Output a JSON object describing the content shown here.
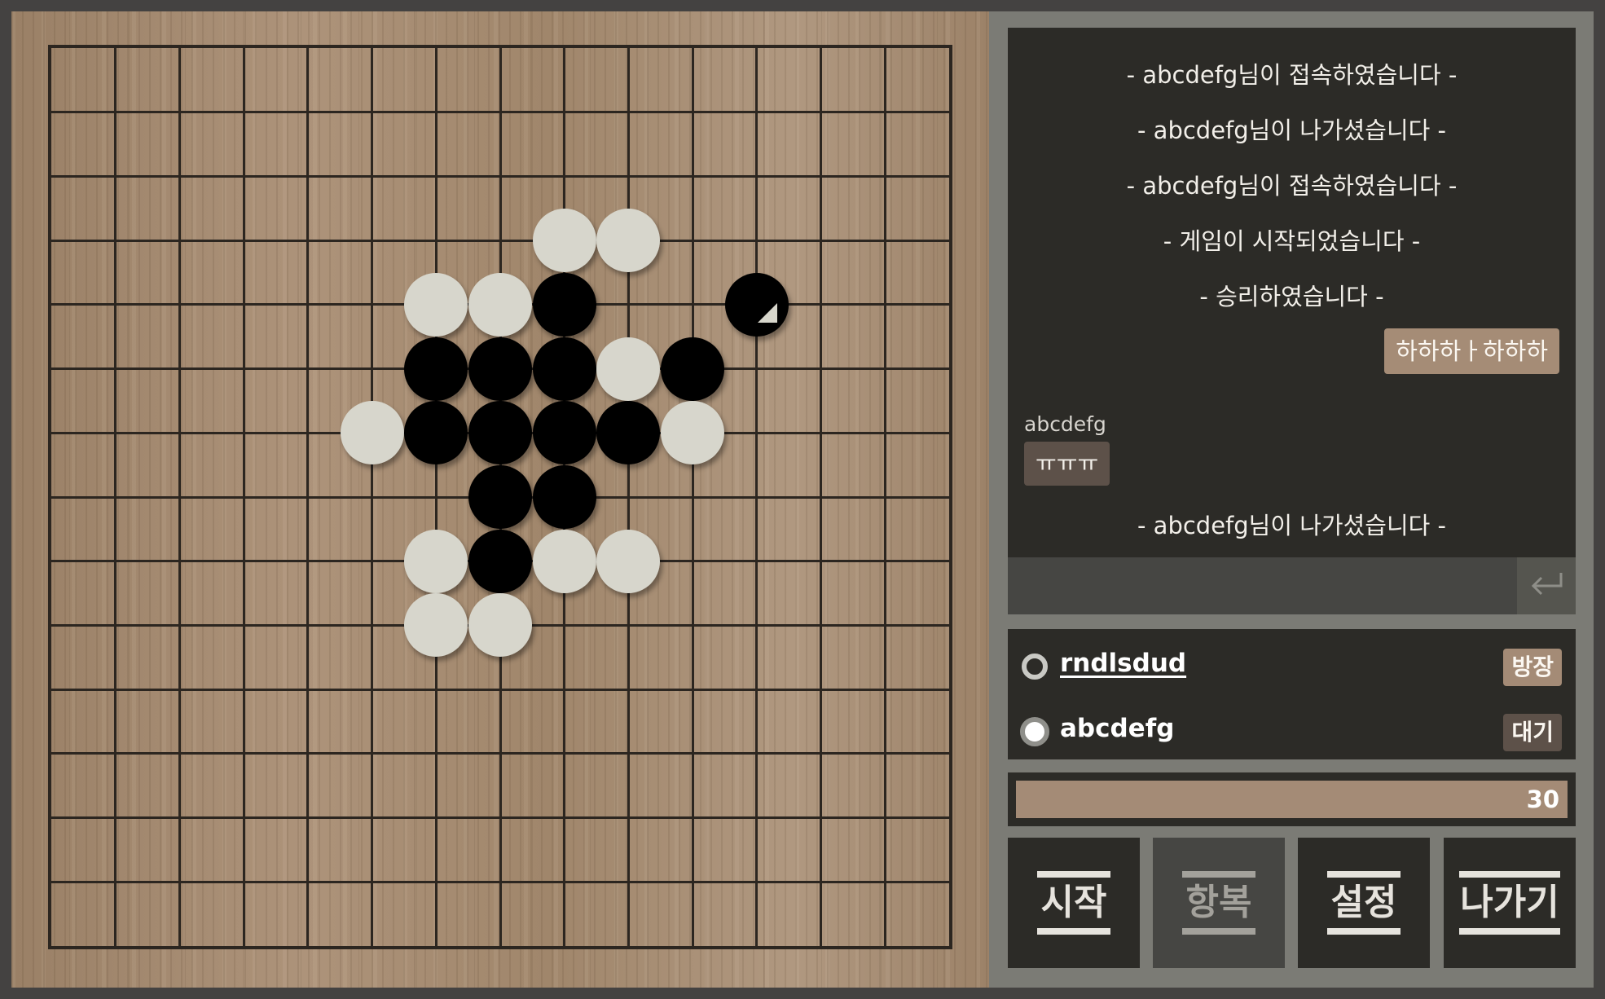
{
  "board": {
    "size": 15,
    "stones": [
      {
        "row": 3,
        "col": 8,
        "color": "white"
      },
      {
        "row": 3,
        "col": 9,
        "color": "white"
      },
      {
        "row": 4,
        "col": 6,
        "color": "white"
      },
      {
        "row": 4,
        "col": 7,
        "color": "white"
      },
      {
        "row": 4,
        "col": 8,
        "color": "black"
      },
      {
        "row": 4,
        "col": 11,
        "color": "black",
        "last_move": true
      },
      {
        "row": 5,
        "col": 6,
        "color": "black"
      },
      {
        "row": 5,
        "col": 7,
        "color": "black"
      },
      {
        "row": 5,
        "col": 8,
        "color": "black"
      },
      {
        "row": 5,
        "col": 9,
        "color": "white"
      },
      {
        "row": 5,
        "col": 10,
        "color": "black"
      },
      {
        "row": 6,
        "col": 5,
        "color": "white"
      },
      {
        "row": 6,
        "col": 6,
        "color": "black"
      },
      {
        "row": 6,
        "col": 7,
        "color": "black"
      },
      {
        "row": 6,
        "col": 8,
        "color": "black"
      },
      {
        "row": 6,
        "col": 9,
        "color": "black"
      },
      {
        "row": 6,
        "col": 10,
        "color": "white"
      },
      {
        "row": 7,
        "col": 7,
        "color": "black"
      },
      {
        "row": 7,
        "col": 8,
        "color": "black"
      },
      {
        "row": 8,
        "col": 6,
        "color": "white"
      },
      {
        "row": 8,
        "col": 7,
        "color": "black"
      },
      {
        "row": 8,
        "col": 8,
        "color": "white"
      },
      {
        "row": 8,
        "col": 9,
        "color": "white"
      },
      {
        "row": 9,
        "col": 6,
        "color": "white"
      },
      {
        "row": 9,
        "col": 7,
        "color": "white"
      }
    ]
  },
  "chat": {
    "system_messages": [
      "- abcdefg님이 접속하였습니다 -",
      "- abcdefg님이 나가셨습니다 -",
      "- abcdefg님이 접속하였습니다 -",
      "- 게임이 시작되었습니다 -",
      "- 승리하였습니다 -"
    ],
    "my_message": "하하하ㅏ하하하",
    "other_sender": "abcdefg",
    "other_message": "ㅠㅠㅠ",
    "final_system_message": "- abcdefg님이 나가셨습니다 -",
    "input_value": "",
    "send_icon": "enter-arrow-icon"
  },
  "players": [
    {
      "name": "rndlsdud",
      "role": "방장",
      "role_color": "#a48b76"
    },
    {
      "name": "abcdefg",
      "role": "대기",
      "role_color": "#5d5149"
    }
  ],
  "timer": {
    "value": "30",
    "fraction": 1.0
  },
  "buttons": {
    "start": "시작",
    "surrender": "항복",
    "settings": "설정",
    "exit": "나가기"
  }
}
